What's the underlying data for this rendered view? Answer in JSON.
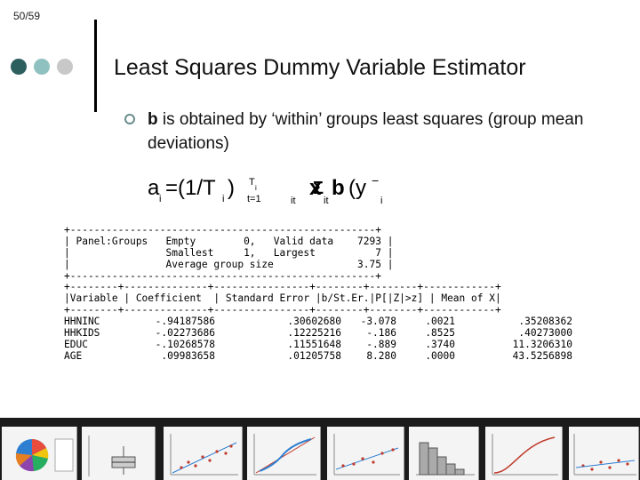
{
  "slide": {
    "page_number": "50/59",
    "title": "Least Squares Dummy Variable Estimator",
    "bullet": {
      "bold": "b",
      "rest": " is obtained by ‘within’ groups least squares (group mean deviations)"
    },
    "formula": {
      "a": "a",
      "i": "i",
      "eq_open": "=(1/T",
      "close": ")",
      "Ti": "T",
      "t1": "t=1",
      "it": "it",
      "x": "x",
      "b": "b",
      "y": "(y",
      "minus": "−"
    }
  },
  "output": {
    "border_top": "+---------------------------------------------------+",
    "panel_line1": "| Panel:Groups   Empty        0,   Valid data    7293 |",
    "panel_line2": "|                Smallest     1,   Largest          7 |",
    "panel_line3": "|                Average group size              3.75 |",
    "border_mid": "+--------+--------------+----------------+--------+--------+------------+",
    "header": "|Variable | Coefficient  | Standard Error |b/St.Er.|P[|Z|>z] | Mean of X|",
    "border_bot": "+--------+--------------+----------------+--------+--------+------------+",
    "rows": [
      {
        "var": "HHNINC",
        "coef": "-.94187586",
        "se": ".30602680",
        "t": "-3.078",
        "p": ".0021",
        "mean": ".35208362"
      },
      {
        "var": "HHKIDS",
        "coef": "-.02273686",
        "se": ".12225216",
        "t": "-.186",
        "p": ".8525",
        "mean": ".40273000"
      },
      {
        "var": "EDUC",
        "coef": "-.10268578",
        "se": ".11551648",
        "t": "-.889",
        "p": ".3740",
        "mean": "11.3206310"
      },
      {
        "var": "AGE",
        "coef": ".09983658",
        "se": ".01205758",
        "t": "8.280",
        "p": ".0000",
        "mean": "43.5256898"
      }
    ]
  },
  "colors": {
    "dot1": "#2e5f5f",
    "dot2": "#8fc1c1",
    "dot3": "#c8c8c8",
    "bullet": "#6b8c8c"
  }
}
